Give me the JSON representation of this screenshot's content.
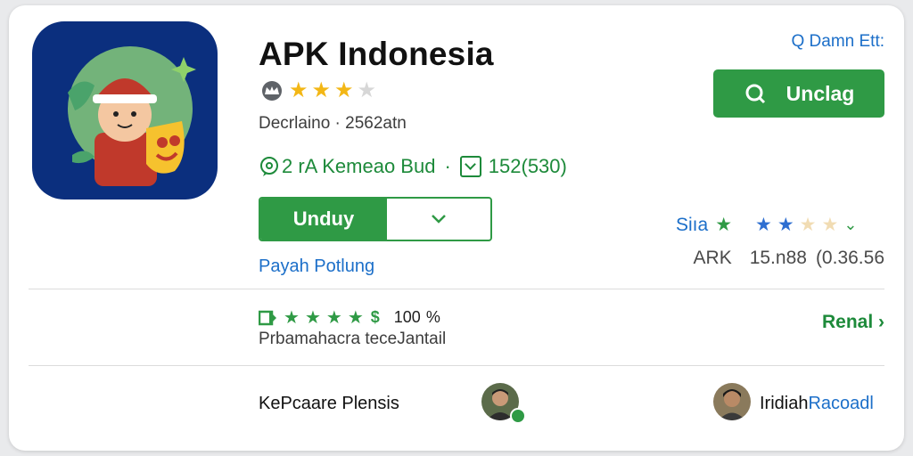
{
  "app": {
    "title": "APK Indonesia",
    "meta": "Decrlaino · 2562atn",
    "stats_text": "2 rA Kemeao Bud",
    "count_text": "152(530)",
    "rating_stars": 3,
    "rating_max": 5
  },
  "actions": {
    "top_link": "Q Damn Ett:",
    "primary_label": "Unclag",
    "split_label": "Unduy",
    "secondary_link": "Payah Potlung"
  },
  "side": {
    "rating_label": "Siıa",
    "apk_label": "ARK",
    "version": "15.n88",
    "size": "(0.36.56"
  },
  "review_stats": {
    "percent_value": "100",
    "percent_unit": "%",
    "subtitle": "Prbamahacra  teceJantail",
    "more_link": "Renal"
  },
  "people": {
    "left_label": "KePcaare Plensis",
    "right_label_prefix": "Iridiah",
    "right_label_suffix": "Racoadl"
  },
  "colors": {
    "green": "#2f9a45",
    "blue": "#1c6fc9",
    "icon_bg": "#0b2f7e",
    "star": "#f3b716"
  },
  "icons": [
    "crown-icon",
    "speech-bubble-icon",
    "checkbox-icon",
    "chevron-down-icon",
    "search-icon",
    "star-icon",
    "download-square-icon",
    "chevron-right-icon"
  ]
}
